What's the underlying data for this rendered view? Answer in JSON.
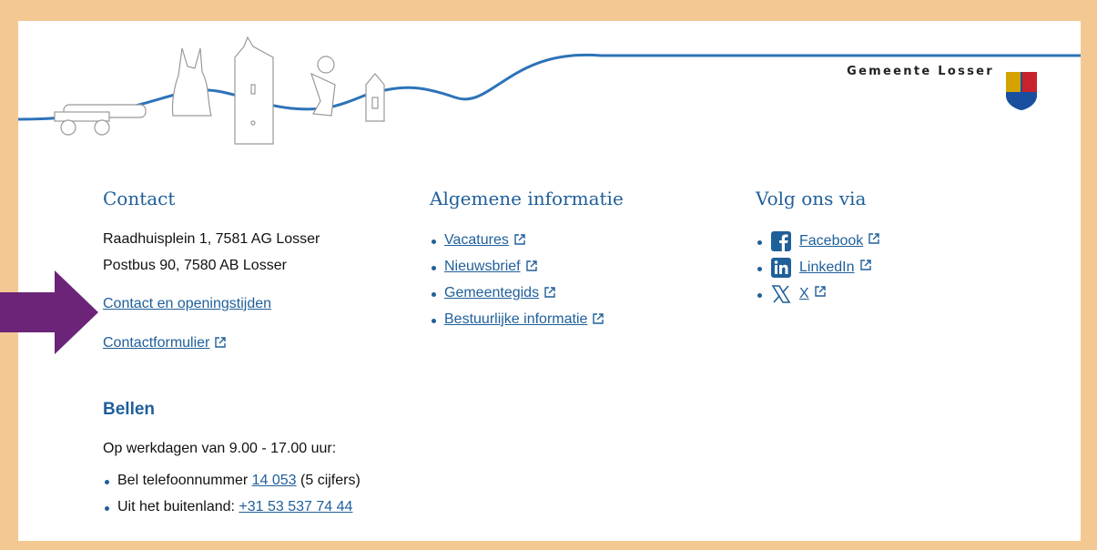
{
  "brand": {
    "name": "Gemeente Losser"
  },
  "contact": {
    "title": "Contact",
    "address": "Raadhuisplein 1, 7581 AG Losser",
    "postbus": "Postbus 90, 7580 AB Losser",
    "link_openingstijden": "Contact en openingstijden",
    "link_form": "Contactformulier"
  },
  "algemeen": {
    "title": "Algemene informatie",
    "items": [
      "Vacatures",
      "Nieuwsbrief",
      "Gemeentegids",
      "Bestuurlijke informatie"
    ]
  },
  "volg": {
    "title": "Volg ons via",
    "items": [
      {
        "label": "Facebook",
        "icon": "facebook-icon"
      },
      {
        "label": "LinkedIn",
        "icon": "linkedin-icon"
      },
      {
        "label": "X",
        "icon": "x-icon"
      }
    ]
  },
  "bellen": {
    "title": "Bellen",
    "hours": "Op werkdagen van 9.00 - 17.00 uur:",
    "phone_prefix": "Bel telefoonnummer ",
    "phone_number": "14 053",
    "phone_suffix": " (5 cijfers)",
    "abroad_prefix": "Uit het buitenland: ",
    "abroad_number": "+31 53 537 74 44"
  },
  "colors": {
    "link": "#1f5f9a",
    "frame": "#f4c893",
    "arrow": "#6b2478"
  }
}
